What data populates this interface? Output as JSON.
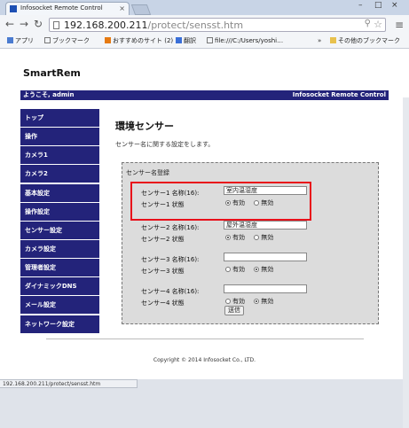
{
  "browser": {
    "tab_title": "Infosocket Remote Control",
    "tab_close": "×",
    "url_host": "192.168.200.211",
    "url_path": "/protect/sensst.htm",
    "window_controls": [
      "–",
      "□",
      "×"
    ],
    "bookmarks": [
      "アプリ",
      "ブックマーク",
      "おすすめのサイト (2)",
      "翻訳",
      "file:///C:/Users/yoshi…",
      "その他のブックマーク"
    ],
    "bookmarks_overflow": "»",
    "status_url": "192.168.200.211/protect/sensst.htm",
    "icons": {
      "back": "back-arrow-icon",
      "forward": "forward-arrow-icon",
      "reload": "reload-icon",
      "star": "star-icon",
      "menu": "menu-icon"
    }
  },
  "site": {
    "title": "SmartRem",
    "welcome": "ようこそ, admin",
    "brand": "Infosocket Remote Control"
  },
  "nav": [
    "トップ",
    "操作",
    "カメラ1",
    "カメラ2",
    "基本設定",
    "操作設定",
    "センサー設定",
    "カメラ設定",
    "管理者設定",
    "ダイナミックDNS",
    "メール設定",
    "ネットワーク設定"
  ],
  "content": {
    "title": "環境センサー",
    "description": "センサー名に関する設定をします。",
    "legend": "センサー名登録",
    "save_label": "送信",
    "sensors": [
      {
        "name_label": "センサー1 名称(16):",
        "state_label": "センサー1 状態",
        "name_value": "室内温湿度",
        "opt_on": "有効",
        "opt_off": "無効",
        "selected": "on"
      },
      {
        "name_label": "センサー2 名称(16):",
        "state_label": "センサー2 状態",
        "name_value": "屋外温湿度",
        "opt_on": "有効",
        "opt_off": "無効",
        "selected": "on"
      },
      {
        "name_label": "センサー3 名称(16):",
        "state_label": "センサー3 状態",
        "name_value": "",
        "opt_on": "有効",
        "opt_off": "無効",
        "selected": "off"
      },
      {
        "name_label": "センサー4 名称(16):",
        "state_label": "センサー4 状態",
        "name_value": "",
        "opt_on": "有効",
        "opt_off": "無効",
        "selected": "off"
      }
    ],
    "copyright": "Copyright © 2014 Infosocket Co., LTD."
  },
  "colors": {
    "nav_bg": "#23237a",
    "highlight": "#e8101a"
  }
}
